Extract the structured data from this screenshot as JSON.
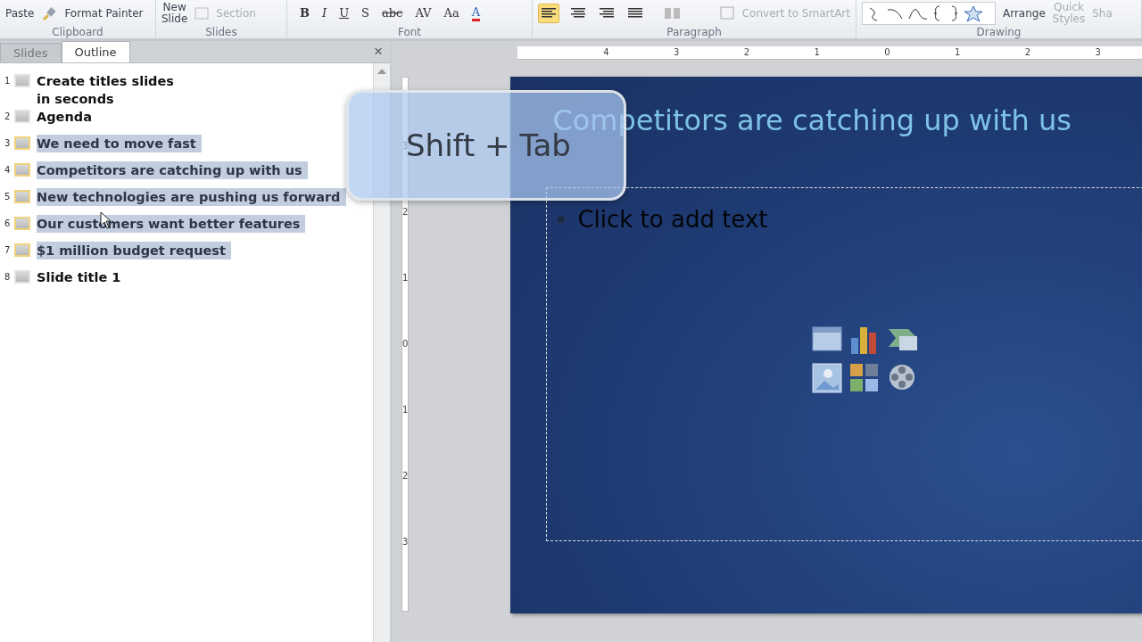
{
  "ribbon": {
    "groups": [
      {
        "kind": "clipboard",
        "label": "Clipboard",
        "paste": "Paste",
        "format_painter": "Format Painter"
      },
      {
        "kind": "slides",
        "label": "Slides",
        "new_slide": [
          "New",
          "Slide"
        ],
        "section": "Section"
      },
      {
        "kind": "font",
        "label": "Font",
        "buttons": [
          "B",
          "I",
          "U",
          "S",
          "abc",
          "AV",
          "Aa",
          "A"
        ]
      },
      {
        "kind": "paragraph",
        "label": "Paragraph",
        "smartart": "Convert to SmartArt"
      },
      {
        "kind": "drawing",
        "label": "Drawing",
        "arrange": "Arrange",
        "quick_styles": [
          "Quick",
          "Styles"
        ],
        "shape_effects": "Sha"
      }
    ]
  },
  "outline_pane": {
    "tabs": [
      {
        "label": "Slides",
        "selected": false
      },
      {
        "label": "Outline",
        "selected": true
      }
    ],
    "close": "×",
    "items": [
      {
        "number": "1",
        "title": "Create titles slides\nin seconds",
        "selected": false
      },
      {
        "number": "2",
        "title": "Agenda",
        "selected": false
      },
      {
        "number": "3",
        "title": "We need to move fast",
        "selected": true
      },
      {
        "number": "4",
        "title": "Competitors  are catching  up with  us",
        "selected": true
      },
      {
        "number": "5",
        "title": "New  technologies  are pushing  us forward",
        "selected": true
      },
      {
        "number": "6",
        "title": "Our customers  want  better features",
        "selected": true
      },
      {
        "number": "7",
        "title": "$1 million  budget request",
        "selected": true
      },
      {
        "number": "8",
        "title": "Slide  title 1",
        "selected": false
      }
    ]
  },
  "rulers": {
    "horizontal": [
      "4",
      "3",
      "2",
      "1",
      "0",
      "1",
      "2",
      "3"
    ],
    "vertical": [
      "3",
      "2",
      "1",
      "0",
      "1",
      "2",
      "3"
    ]
  },
  "slide": {
    "title": "Competitors are catching up with us",
    "body_placeholder": "Click to add text"
  },
  "overlay": {
    "keys": "Shift + Tab"
  }
}
